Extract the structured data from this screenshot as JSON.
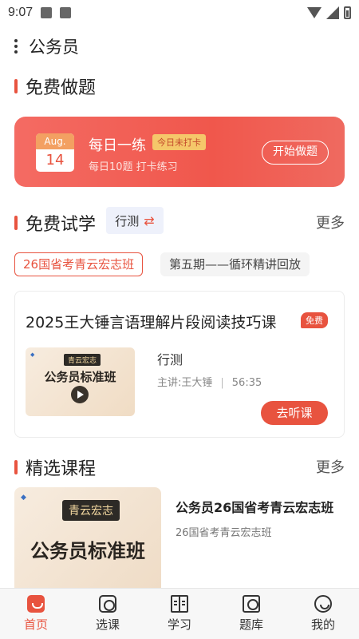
{
  "status_bar": {
    "time": "9:07"
  },
  "header": {
    "title": "公务员"
  },
  "free_practice": {
    "section_title": "免费做题",
    "card": {
      "cal_month": "Aug.",
      "cal_day": "14",
      "title": "每日一练",
      "badge": "今日未打卡",
      "subtitle": "每日10题 打卡练习",
      "button": "开始做题"
    }
  },
  "free_trial": {
    "section_title": "免费试学",
    "subject_chip": "行测",
    "more": "更多",
    "tabs": [
      {
        "label": "26国省考青云宏志班"
      },
      {
        "label": "第五期——循环精讲回放"
      }
    ],
    "course": {
      "title": "2025王大锤言语理解片段阅读技巧课",
      "badge": "免费",
      "thumb_tag": "青云宏志",
      "thumb_main": "公务员标准班",
      "subject": "行测",
      "lecturer": "主讲:王大锤",
      "duration": "56:35",
      "button": "去听课"
    }
  },
  "selected_courses": {
    "section_title": "精选课程",
    "more": "更多",
    "item": {
      "thumb_tag": "青云宏志",
      "thumb_main": "公务员标准班",
      "title": "公务员26国省考青云宏志班",
      "subtitle": "26国省考青云宏志班"
    }
  },
  "bottom_nav": {
    "items": [
      {
        "label": "首页",
        "icon": "home-icon"
      },
      {
        "label": "选课",
        "icon": "course-icon"
      },
      {
        "label": "学习",
        "icon": "study-icon"
      },
      {
        "label": "题库",
        "icon": "question-bank-icon"
      },
      {
        "label": "我的",
        "icon": "profile-icon"
      }
    ]
  },
  "colors": {
    "accent": "#e8533f",
    "card_gradient_start": "#f46b63"
  }
}
